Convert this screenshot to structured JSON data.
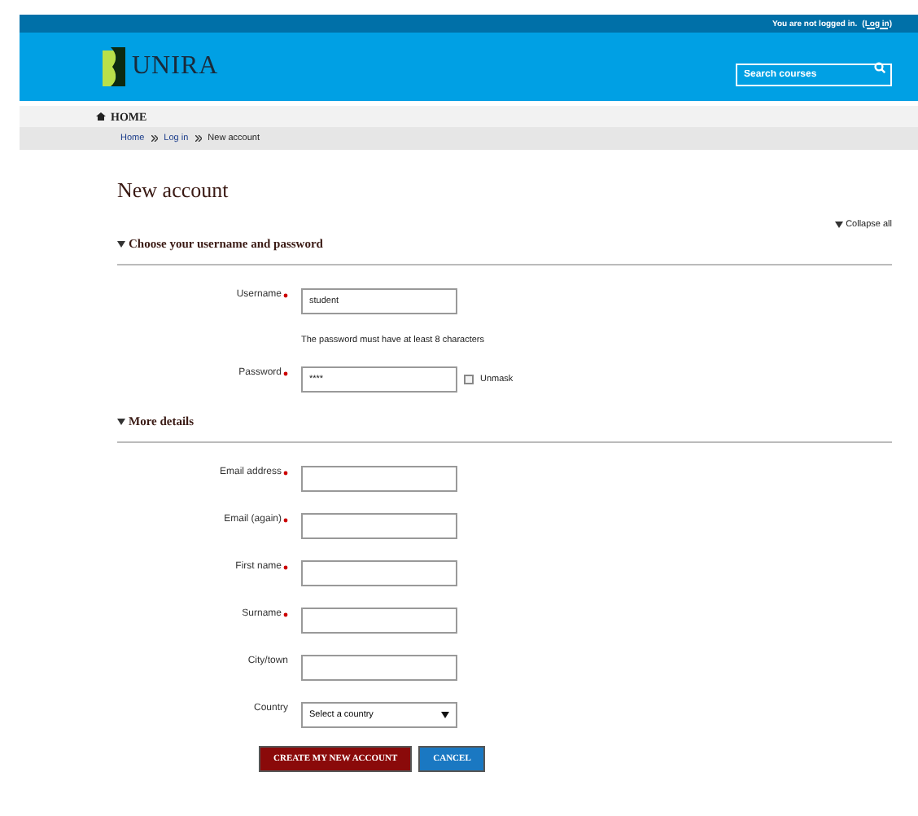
{
  "top_bar": {
    "status": "You are not logged in.",
    "login_link": "(Log in)"
  },
  "header": {
    "logo": "UNIRA",
    "search": {
      "placeholder": "Search courses"
    }
  },
  "nav": {
    "home": "HOME"
  },
  "breadcrumb": [
    "Home",
    "Log in",
    "New account"
  ],
  "page_title": "New account",
  "collapse_all": "Collapse all",
  "sections": [
    {
      "title": "Choose your username and password",
      "expanded": true,
      "fields": [
        {
          "kind": "text",
          "label": "Username",
          "required": true,
          "value": "student"
        },
        {
          "kind": "note",
          "text": "The password must have at least 8 characters"
        },
        {
          "kind": "password",
          "label": "Password",
          "required": true,
          "value": "****",
          "unmask": {
            "label": "Unmask",
            "checked": false
          }
        }
      ]
    },
    {
      "title": "More details",
      "expanded": true,
      "fields": [
        {
          "kind": "text",
          "label": "Email address",
          "required": true
        },
        {
          "kind": "text",
          "label": "Email (again)",
          "required": true
        },
        {
          "kind": "text",
          "label": "First name",
          "required": true
        },
        {
          "kind": "text",
          "label": "Surname",
          "required": true
        },
        {
          "kind": "text",
          "label": "City/town",
          "required": false
        },
        {
          "kind": "select",
          "label": "Country",
          "required": false,
          "value": "Select a country"
        }
      ]
    }
  ],
  "buttons": [
    {
      "kind": "primary",
      "label": "CREATE MY NEW ACCOUNT"
    },
    {
      "kind": "secondary",
      "label": "CANCEL"
    }
  ]
}
